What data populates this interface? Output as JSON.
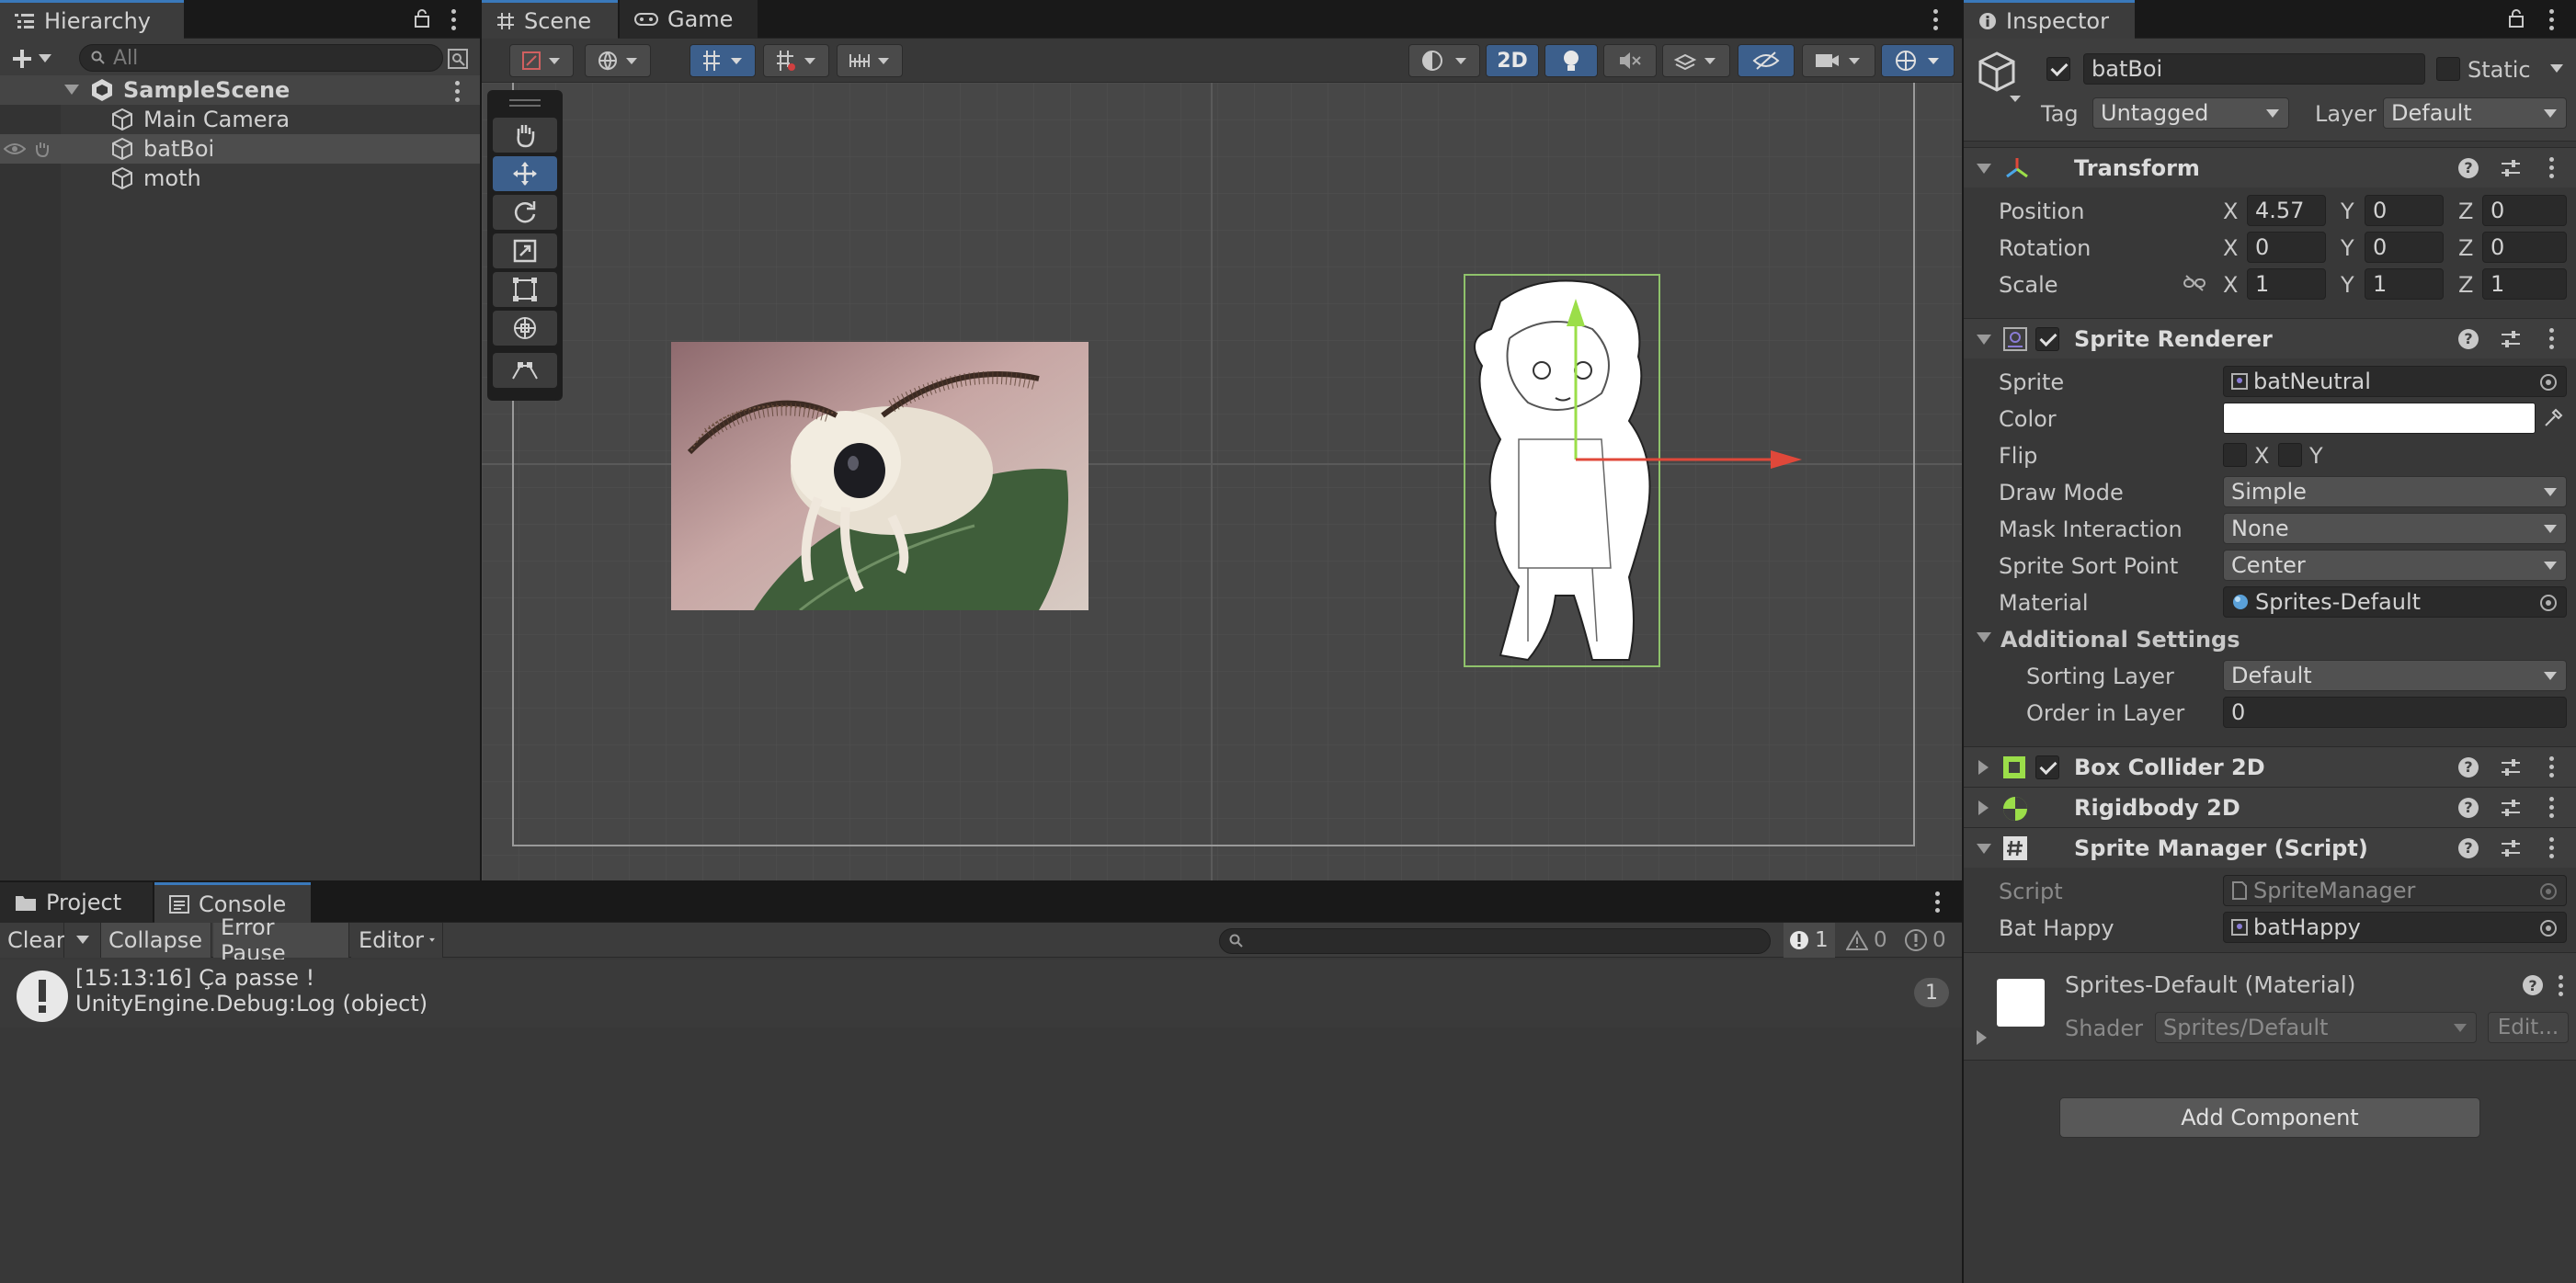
{
  "hierarchy": {
    "tab_label": "Hierarchy",
    "search_placeholder": "All",
    "scene_name": "SampleScene",
    "items": [
      {
        "label": "Main Camera"
      },
      {
        "label": "batBoi"
      },
      {
        "label": "moth"
      }
    ]
  },
  "scene_view": {
    "tabs": [
      {
        "label": "Scene"
      },
      {
        "label": "Game"
      }
    ],
    "mode_2d_label": "2D"
  },
  "inspector": {
    "tab_label": "Inspector",
    "object_name": "batBoi",
    "static_label": "Static",
    "tag_label": "Tag",
    "tag_value": "Untagged",
    "layer_label": "Layer",
    "layer_value": "Default",
    "transform": {
      "title": "Transform",
      "position_label": "Position",
      "rotation_label": "Rotation",
      "scale_label": "Scale",
      "position": {
        "x": "4.57",
        "y": "0",
        "z": "0"
      },
      "rotation": {
        "x": "0",
        "y": "0",
        "z": "0"
      },
      "scale": {
        "x": "1",
        "y": "1",
        "z": "1"
      },
      "axis_x": "X",
      "axis_y": "Y",
      "axis_z": "Z"
    },
    "sprite_renderer": {
      "title": "Sprite Renderer",
      "sprite_label": "Sprite",
      "sprite_value": "batNeutral",
      "color_label": "Color",
      "color_value": "#ffffff",
      "flip_label": "Flip",
      "flip_x": "X",
      "flip_y": "Y",
      "draw_mode_label": "Draw Mode",
      "draw_mode_value": "Simple",
      "mask_label": "Mask Interaction",
      "mask_value": "None",
      "sort_point_label": "Sprite Sort Point",
      "sort_point_value": "Center",
      "material_label": "Material",
      "material_value": "Sprites-Default",
      "additional_label": "Additional Settings",
      "sorting_layer_label": "Sorting Layer",
      "sorting_layer_value": "Default",
      "order_label": "Order in Layer",
      "order_value": "0"
    },
    "box_collider": {
      "title": "Box Collider 2D"
    },
    "rigidbody": {
      "title": "Rigidbody 2D"
    },
    "sprite_manager": {
      "title": "Sprite Manager (Script)",
      "script_label": "Script",
      "script_value": "SpriteManager",
      "bat_happy_label": "Bat Happy",
      "bat_happy_value": "batHappy"
    },
    "material_block": {
      "title": "Sprites-Default (Material)",
      "shader_label": "Shader",
      "shader_value": "Sprites/Default",
      "edit_label": "Edit..."
    },
    "add_component_label": "Add Component"
  },
  "console": {
    "tabs": [
      {
        "label": "Project"
      },
      {
        "label": "Console"
      }
    ],
    "clear_label": "Clear",
    "collapse_label": "Collapse",
    "error_pause_label": "Error Pause",
    "editor_label": "Editor",
    "counts": {
      "info": "1",
      "warn": "0",
      "error": "0"
    },
    "entry": {
      "line1": "[15:13:16] Ça passe !",
      "line2": "UnityEngine.Debug:Log (object)",
      "count": "1"
    }
  },
  "colors": {
    "accent": "#3a79bb",
    "selection": "#4d4d4d",
    "panel": "#383838"
  }
}
